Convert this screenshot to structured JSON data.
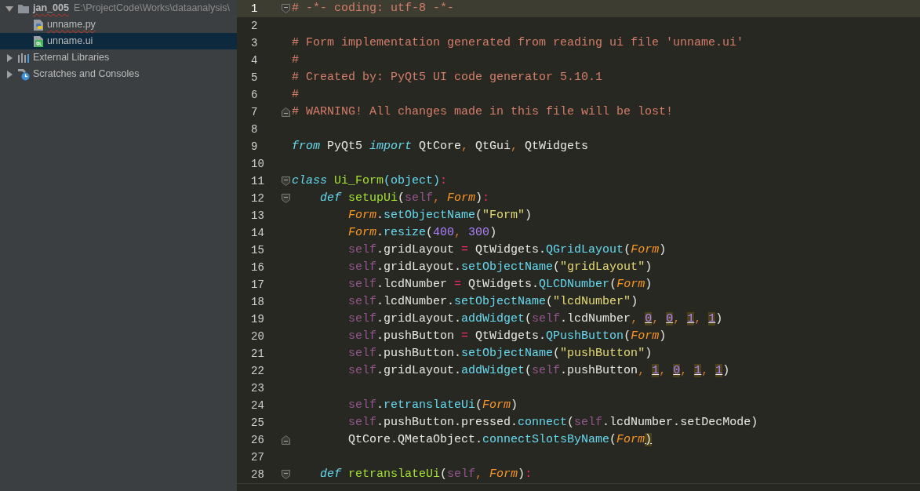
{
  "project_tree": [
    {
      "label": "jan_005",
      "path": "E:\\ProjectCode\\Works\\dataanalysis\\",
      "kind": "folder",
      "expanded": true,
      "selected": false,
      "error": true,
      "children": [
        {
          "label": "unname.py",
          "kind": "python-file",
          "selected": false,
          "error": true
        },
        {
          "label": "unname.ui",
          "kind": "qt-file",
          "selected": true,
          "error": false
        }
      ]
    },
    {
      "label": "External Libraries",
      "kind": "libraries",
      "expanded": false,
      "selected": false,
      "error": false
    },
    {
      "label": "Scratches and Consoles",
      "kind": "scratches",
      "expanded": false,
      "selected": false,
      "error": false
    }
  ],
  "editor": {
    "lines": [
      {
        "number": "1",
        "selected": true,
        "fold_start": true,
        "fold_end": false,
        "tokens": [
          {
            "kind": "c",
            "text": "# -*- coding: utf-8 -*-"
          }
        ]
      },
      {
        "number": "2",
        "selected": false,
        "fold_start": false,
        "fold_end": false
      },
      {
        "number": "3",
        "selected": false,
        "fold_start": false,
        "fold_end": false,
        "tokens": [
          {
            "kind": "c",
            "text": "# Form implementation generated from reading ui file 'unname.ui'"
          }
        ]
      },
      {
        "number": "4",
        "selected": false,
        "fold_start": false,
        "fold_end": false,
        "tokens": [
          {
            "kind": "c",
            "text": "#"
          }
        ]
      },
      {
        "number": "5",
        "selected": false,
        "fold_start": false,
        "fold_end": false,
        "tokens": [
          {
            "kind": "c",
            "text": "# Created by: PyQt5 UI code generator 5.10.1"
          }
        ]
      },
      {
        "number": "6",
        "selected": false,
        "fold_start": false,
        "fold_end": false,
        "tokens": [
          {
            "kind": "c",
            "text": "#"
          }
        ]
      },
      {
        "number": "7",
        "selected": false,
        "fold_start": false,
        "fold_end": true,
        "tokens": [
          {
            "kind": "c",
            "text": "# WARNING! All changes made in this file will be lost!"
          }
        ]
      },
      {
        "number": "8",
        "selected": false,
        "fold_start": false,
        "fold_end": false
      },
      {
        "number": "9",
        "selected": false,
        "fold_start": false,
        "fold_end": false,
        "tokens": [
          {
            "kind": "kw",
            "text": "from"
          },
          {
            "kind": "p",
            "text": " PyQt5 "
          },
          {
            "kind": "kw",
            "text": "import"
          },
          {
            "kind": "p",
            "text": " QtCore"
          },
          {
            "kind": "pu",
            "text": ","
          },
          {
            "kind": "p",
            "text": " QtGui"
          },
          {
            "kind": "pu",
            "text": ","
          },
          {
            "kind": "p",
            "text": " QtWidgets"
          }
        ]
      },
      {
        "number": "10",
        "selected": false,
        "fold_start": false,
        "fold_end": false
      },
      {
        "number": "11",
        "selected": false,
        "fold_start": true,
        "fold_end": false,
        "tokens": [
          {
            "kind": "kw",
            "text": "class"
          },
          {
            "kind": "cls",
            "text": " Ui_Form"
          },
          {
            "kind": "fn",
            "text": "(object)"
          },
          {
            "kind": "op",
            "text": ":"
          }
        ]
      },
      {
        "number": "12",
        "selected": false,
        "fold_start": true,
        "fold_end": false,
        "tokens": [
          {
            "kind": "kw",
            "text": "    def"
          },
          {
            "kind": "dn",
            "text": " setupUi"
          },
          {
            "kind": "p",
            "text": "("
          },
          {
            "kind": "self",
            "text": "self"
          },
          {
            "kind": "pu",
            "text": ","
          },
          {
            "kind": "par",
            "text": " Form"
          },
          {
            "kind": "p",
            "text": ")"
          },
          {
            "kind": "op",
            "text": ":"
          }
        ]
      },
      {
        "number": "13",
        "selected": false,
        "fold_start": false,
        "fold_end": false,
        "tokens": [
          {
            "kind": "par",
            "text": "        Form"
          },
          {
            "kind": "p",
            "text": "."
          },
          {
            "kind": "fn",
            "text": "setObjectName"
          },
          {
            "kind": "p",
            "text": "("
          },
          {
            "kind": "s",
            "text": "\"Form\""
          },
          {
            "kind": "p",
            "text": ")"
          }
        ]
      },
      {
        "number": "14",
        "selected": false,
        "fold_start": false,
        "fold_end": false,
        "tokens": [
          {
            "kind": "par",
            "text": "        Form"
          },
          {
            "kind": "p",
            "text": "."
          },
          {
            "kind": "fn",
            "text": "resize"
          },
          {
            "kind": "p",
            "text": "("
          },
          {
            "kind": "n",
            "text": "400"
          },
          {
            "kind": "pu",
            "text": ","
          },
          {
            "kind": "n",
            "text": " 300"
          },
          {
            "kind": "p",
            "text": ")"
          }
        ]
      },
      {
        "number": "15",
        "selected": false,
        "fold_start": false,
        "fold_end": false,
        "tokens": [
          {
            "kind": "self",
            "text": "        self"
          },
          {
            "kind": "p",
            "text": ".gridLayout "
          },
          {
            "kind": "op",
            "text": "="
          },
          {
            "kind": "p",
            "text": " QtWidgets."
          },
          {
            "kind": "fn",
            "text": "QGridLayout"
          },
          {
            "kind": "p",
            "text": "("
          },
          {
            "kind": "par",
            "text": "Form"
          },
          {
            "kind": "p",
            "text": ")"
          }
        ]
      },
      {
        "number": "16",
        "selected": false,
        "fold_start": false,
        "fold_end": false,
        "tokens": [
          {
            "kind": "self",
            "text": "        self"
          },
          {
            "kind": "p",
            "text": ".gridLayout."
          },
          {
            "kind": "fn",
            "text": "setObjectName"
          },
          {
            "kind": "p",
            "text": "("
          },
          {
            "kind": "s",
            "text": "\"gridLayout\""
          },
          {
            "kind": "p",
            "text": ")"
          }
        ]
      },
      {
        "number": "17",
        "selected": false,
        "fold_start": false,
        "fold_end": false,
        "tokens": [
          {
            "kind": "self",
            "text": "        self"
          },
          {
            "kind": "p",
            "text": ".lcdNumber "
          },
          {
            "kind": "op",
            "text": "="
          },
          {
            "kind": "p",
            "text": " QtWidgets."
          },
          {
            "kind": "fn",
            "text": "QLCDNumber"
          },
          {
            "kind": "p",
            "text": "("
          },
          {
            "kind": "par",
            "text": "Form"
          },
          {
            "kind": "p",
            "text": ")"
          }
        ]
      },
      {
        "number": "18",
        "selected": false,
        "fold_start": false,
        "fold_end": false,
        "tokens": [
          {
            "kind": "self",
            "text": "        self"
          },
          {
            "kind": "p",
            "text": ".lcdNumber."
          },
          {
            "kind": "fn",
            "text": "setObjectName"
          },
          {
            "kind": "p",
            "text": "("
          },
          {
            "kind": "s",
            "text": "\"lcdNumber\""
          },
          {
            "kind": "p",
            "text": ")"
          }
        ]
      },
      {
        "number": "19",
        "selected": false,
        "fold_start": false,
        "fold_end": false,
        "tokens": [
          {
            "kind": "self",
            "text": "        self"
          },
          {
            "kind": "p",
            "text": ".gridLayout."
          },
          {
            "kind": "fn",
            "text": "addWidget"
          },
          {
            "kind": "p",
            "text": "("
          },
          {
            "kind": "self",
            "text": "self"
          },
          {
            "kind": "p",
            "text": ".lcdNumber"
          },
          {
            "kind": "pu",
            "text": ", "
          },
          {
            "kind": "nh",
            "text": "0"
          },
          {
            "kind": "pu",
            "text": ", "
          },
          {
            "kind": "nh",
            "text": "0"
          },
          {
            "kind": "pu",
            "text": ", "
          },
          {
            "kind": "nh",
            "text": "1"
          },
          {
            "kind": "pu",
            "text": ", "
          },
          {
            "kind": "nh",
            "text": "1"
          },
          {
            "kind": "p",
            "text": ")"
          }
        ]
      },
      {
        "number": "20",
        "selected": false,
        "fold_start": false,
        "fold_end": false,
        "tokens": [
          {
            "kind": "self",
            "text": "        self"
          },
          {
            "kind": "p",
            "text": ".pushButton "
          },
          {
            "kind": "op",
            "text": "="
          },
          {
            "kind": "p",
            "text": " QtWidgets."
          },
          {
            "kind": "fn",
            "text": "QPushButton"
          },
          {
            "kind": "p",
            "text": "("
          },
          {
            "kind": "par",
            "text": "Form"
          },
          {
            "kind": "p",
            "text": ")"
          }
        ]
      },
      {
        "number": "21",
        "selected": false,
        "fold_start": false,
        "fold_end": false,
        "tokens": [
          {
            "kind": "self",
            "text": "        self"
          },
          {
            "kind": "p",
            "text": ".pushButton."
          },
          {
            "kind": "fn",
            "text": "setObjectName"
          },
          {
            "kind": "p",
            "text": "("
          },
          {
            "kind": "s",
            "text": "\"pushButton\""
          },
          {
            "kind": "p",
            "text": ")"
          }
        ]
      },
      {
        "number": "22",
        "selected": false,
        "fold_start": false,
        "fold_end": false,
        "tokens": [
          {
            "kind": "self",
            "text": "        self"
          },
          {
            "kind": "p",
            "text": ".gridLayout."
          },
          {
            "kind": "fn",
            "text": "addWidget"
          },
          {
            "kind": "p",
            "text": "("
          },
          {
            "kind": "self",
            "text": "self"
          },
          {
            "kind": "p",
            "text": ".pushButton"
          },
          {
            "kind": "pu",
            "text": ", "
          },
          {
            "kind": "nh",
            "text": "1"
          },
          {
            "kind": "pu",
            "text": ", "
          },
          {
            "kind": "nh",
            "text": "0"
          },
          {
            "kind": "pu",
            "text": ", "
          },
          {
            "kind": "nh",
            "text": "1"
          },
          {
            "kind": "pu",
            "text": ", "
          },
          {
            "kind": "nh",
            "text": "1"
          },
          {
            "kind": "p",
            "text": ")"
          }
        ]
      },
      {
        "number": "23",
        "selected": false,
        "fold_start": false,
        "fold_end": false
      },
      {
        "number": "24",
        "selected": false,
        "fold_start": false,
        "fold_end": false,
        "tokens": [
          {
            "kind": "self",
            "text": "        self"
          },
          {
            "kind": "p",
            "text": "."
          },
          {
            "kind": "fn",
            "text": "retranslateUi"
          },
          {
            "kind": "p",
            "text": "("
          },
          {
            "kind": "par",
            "text": "Form"
          },
          {
            "kind": "p",
            "text": ")"
          }
        ]
      },
      {
        "number": "25",
        "selected": false,
        "fold_start": false,
        "fold_end": false,
        "tokens": [
          {
            "kind": "self",
            "text": "        self"
          },
          {
            "kind": "p",
            "text": ".pushButton.pressed."
          },
          {
            "kind": "fn",
            "text": "connect"
          },
          {
            "kind": "p",
            "text": "("
          },
          {
            "kind": "self",
            "text": "self"
          },
          {
            "kind": "p",
            "text": ".lcdNumber.setDecMode)"
          }
        ]
      },
      {
        "number": "26",
        "selected": false,
        "fold_start": false,
        "fold_end": true,
        "tokens": [
          {
            "kind": "p",
            "text": "        QtCore.QMetaObject."
          },
          {
            "kind": "fn",
            "text": "connectSlotsByName"
          },
          {
            "kind": "p",
            "text": "("
          },
          {
            "kind": "par",
            "text": "Form"
          },
          {
            "kind": "ph",
            "text": ")"
          }
        ]
      },
      {
        "number": "27",
        "selected": false,
        "fold_start": false,
        "fold_end": false
      },
      {
        "number": "28",
        "selected": false,
        "fold_start": true,
        "fold_end": false,
        "tokens": [
          {
            "kind": "kw",
            "text": "    def"
          },
          {
            "kind": "dn",
            "text": " retranslateUi"
          },
          {
            "kind": "p",
            "text": "("
          },
          {
            "kind": "self",
            "text": "self"
          },
          {
            "kind": "pu",
            "text": ","
          },
          {
            "kind": "par",
            "text": " Form"
          },
          {
            "kind": "p",
            "text": ")"
          },
          {
            "kind": "op",
            "text": ":"
          }
        ]
      }
    ]
  }
}
